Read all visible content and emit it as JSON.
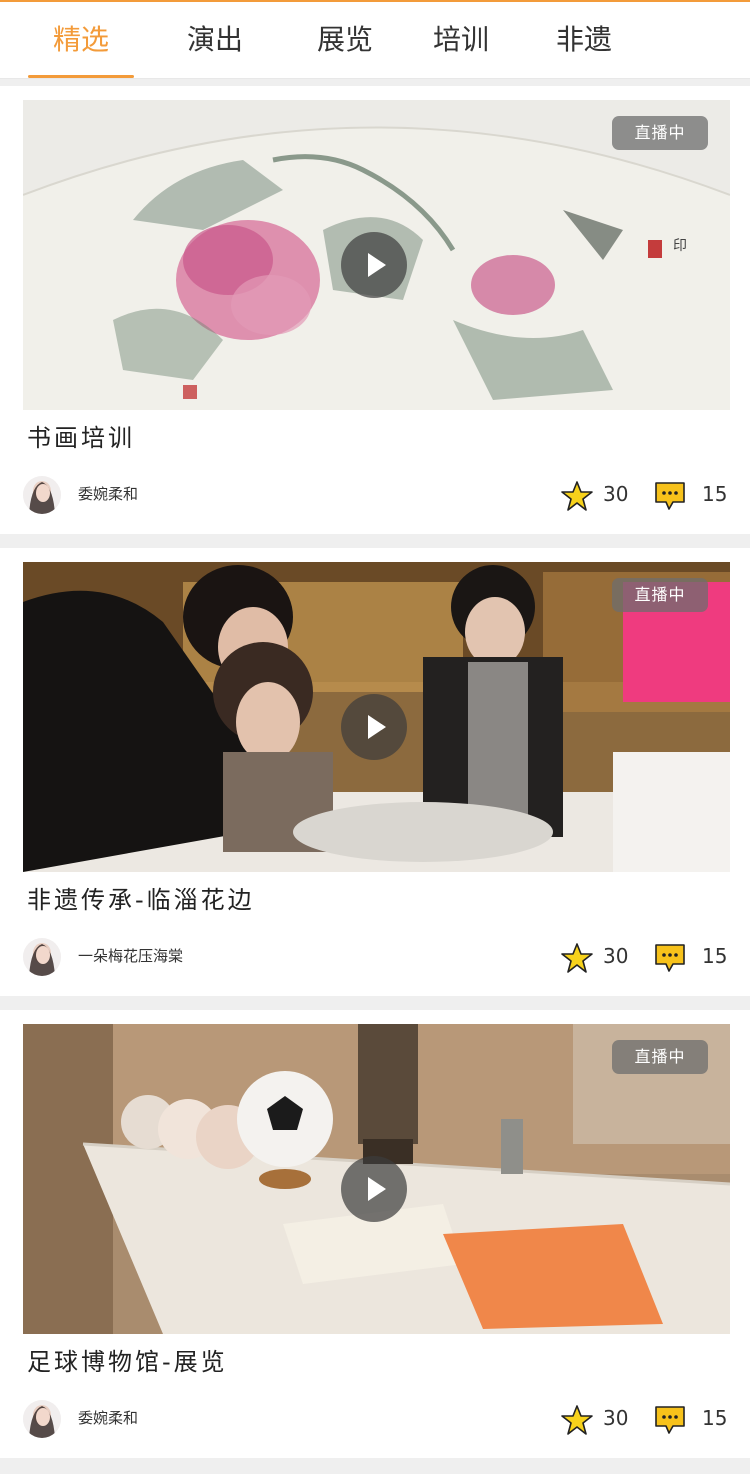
{
  "tabs": [
    {
      "label": "精选",
      "active": true
    },
    {
      "label": "演出",
      "active": false
    },
    {
      "label": "展览",
      "active": false
    },
    {
      "label": "培训",
      "active": false
    },
    {
      "label": "非遗",
      "active": false
    }
  ],
  "colors": {
    "accent": "#f39b3a",
    "star": "#f7d21b",
    "comment": "#f7c21b"
  },
  "cards": [
    {
      "title": "书画培训",
      "badge": "直播中",
      "author": "委婉柔和",
      "favorites": "30",
      "comments": "15",
      "image_icon": "ink-painting-peony-image"
    },
    {
      "title": "非遗传承-临淄花边",
      "badge": "直播中",
      "author": "一朵梅花压海棠",
      "favorites": "30",
      "comments": "15",
      "image_icon": "lace-making-photo-image"
    },
    {
      "title": "足球博物馆-展览",
      "badge": "直播中",
      "author": "委婉柔和",
      "favorites": "30",
      "comments": "15",
      "image_icon": "football-museum-exhibit-image"
    }
  ]
}
